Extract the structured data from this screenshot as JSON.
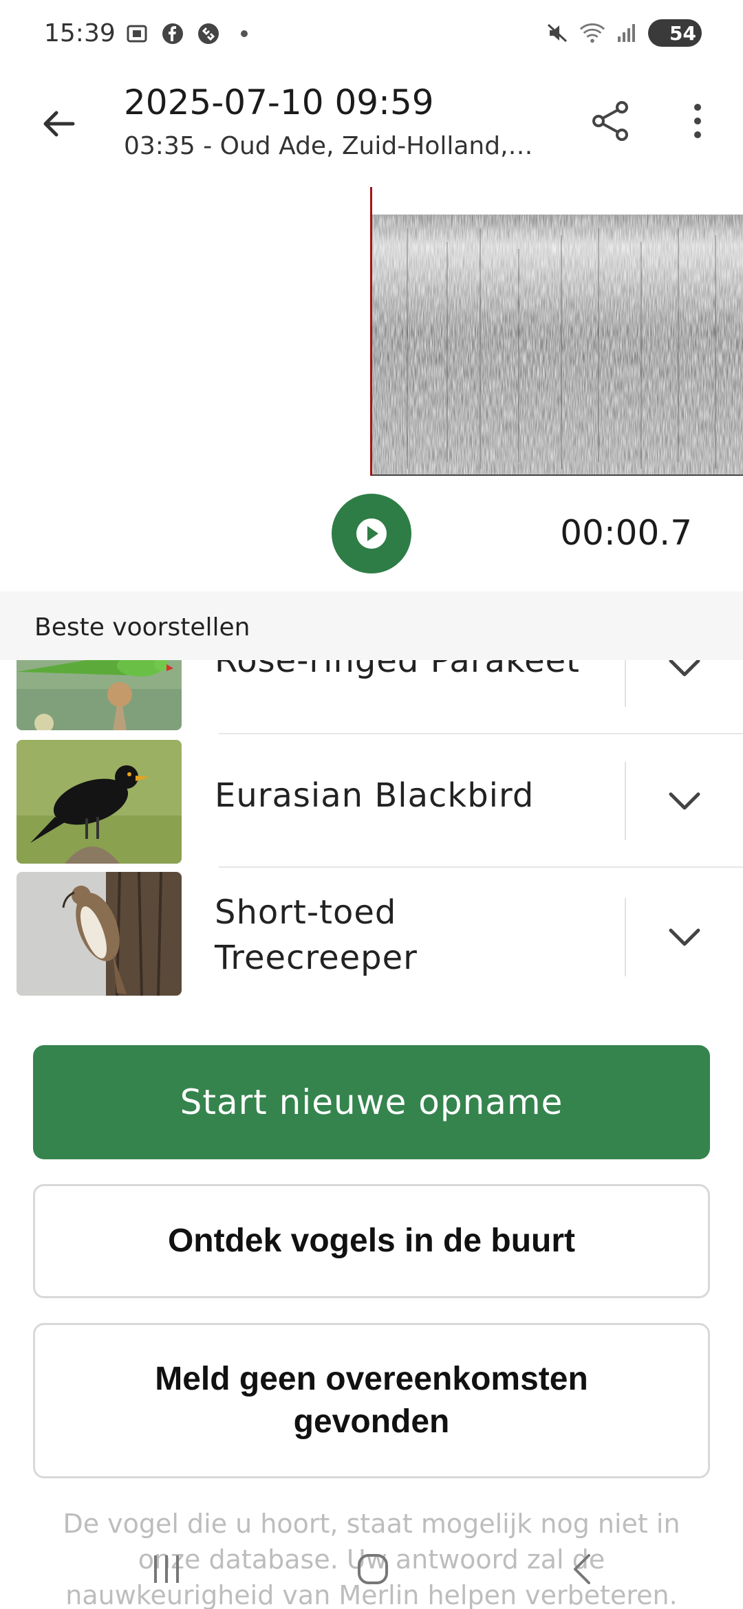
{
  "status_bar": {
    "time": "15:39",
    "battery": "54",
    "icons_left": [
      "screenshot-icon",
      "facebook-icon",
      "shazam-icon",
      "dot-icon"
    ],
    "icons_right": [
      "mute-icon",
      "wifi-icon",
      "signal-icon",
      "battery-icon"
    ]
  },
  "header": {
    "title": "2025-07-10 09:59",
    "subtitle": "03:35 - Oud Ade, Zuid-Holland,…"
  },
  "player": {
    "time": "00:00.7"
  },
  "suggestions": {
    "heading": "Beste voorstellen",
    "items": [
      {
        "name": "Rose-ringed Parakeet"
      },
      {
        "name": "Eurasian Blackbird"
      },
      {
        "name": "Short-toed Treecreeper"
      }
    ]
  },
  "actions": {
    "start_recording": "Start nieuwe opname",
    "discover_birds": "Ontdek vogels in de buurt",
    "report_no_match": "Meld geen overeenkomsten gevonden"
  },
  "footnote": "De vogel die u hoort, staat mogelijk nog niet in onze database. Uw antwoord zal de nauwkeurigheid van Merlin helpen verbeteren.",
  "colors": {
    "primary_green": "#35844d",
    "playhead_red": "#a01515"
  }
}
